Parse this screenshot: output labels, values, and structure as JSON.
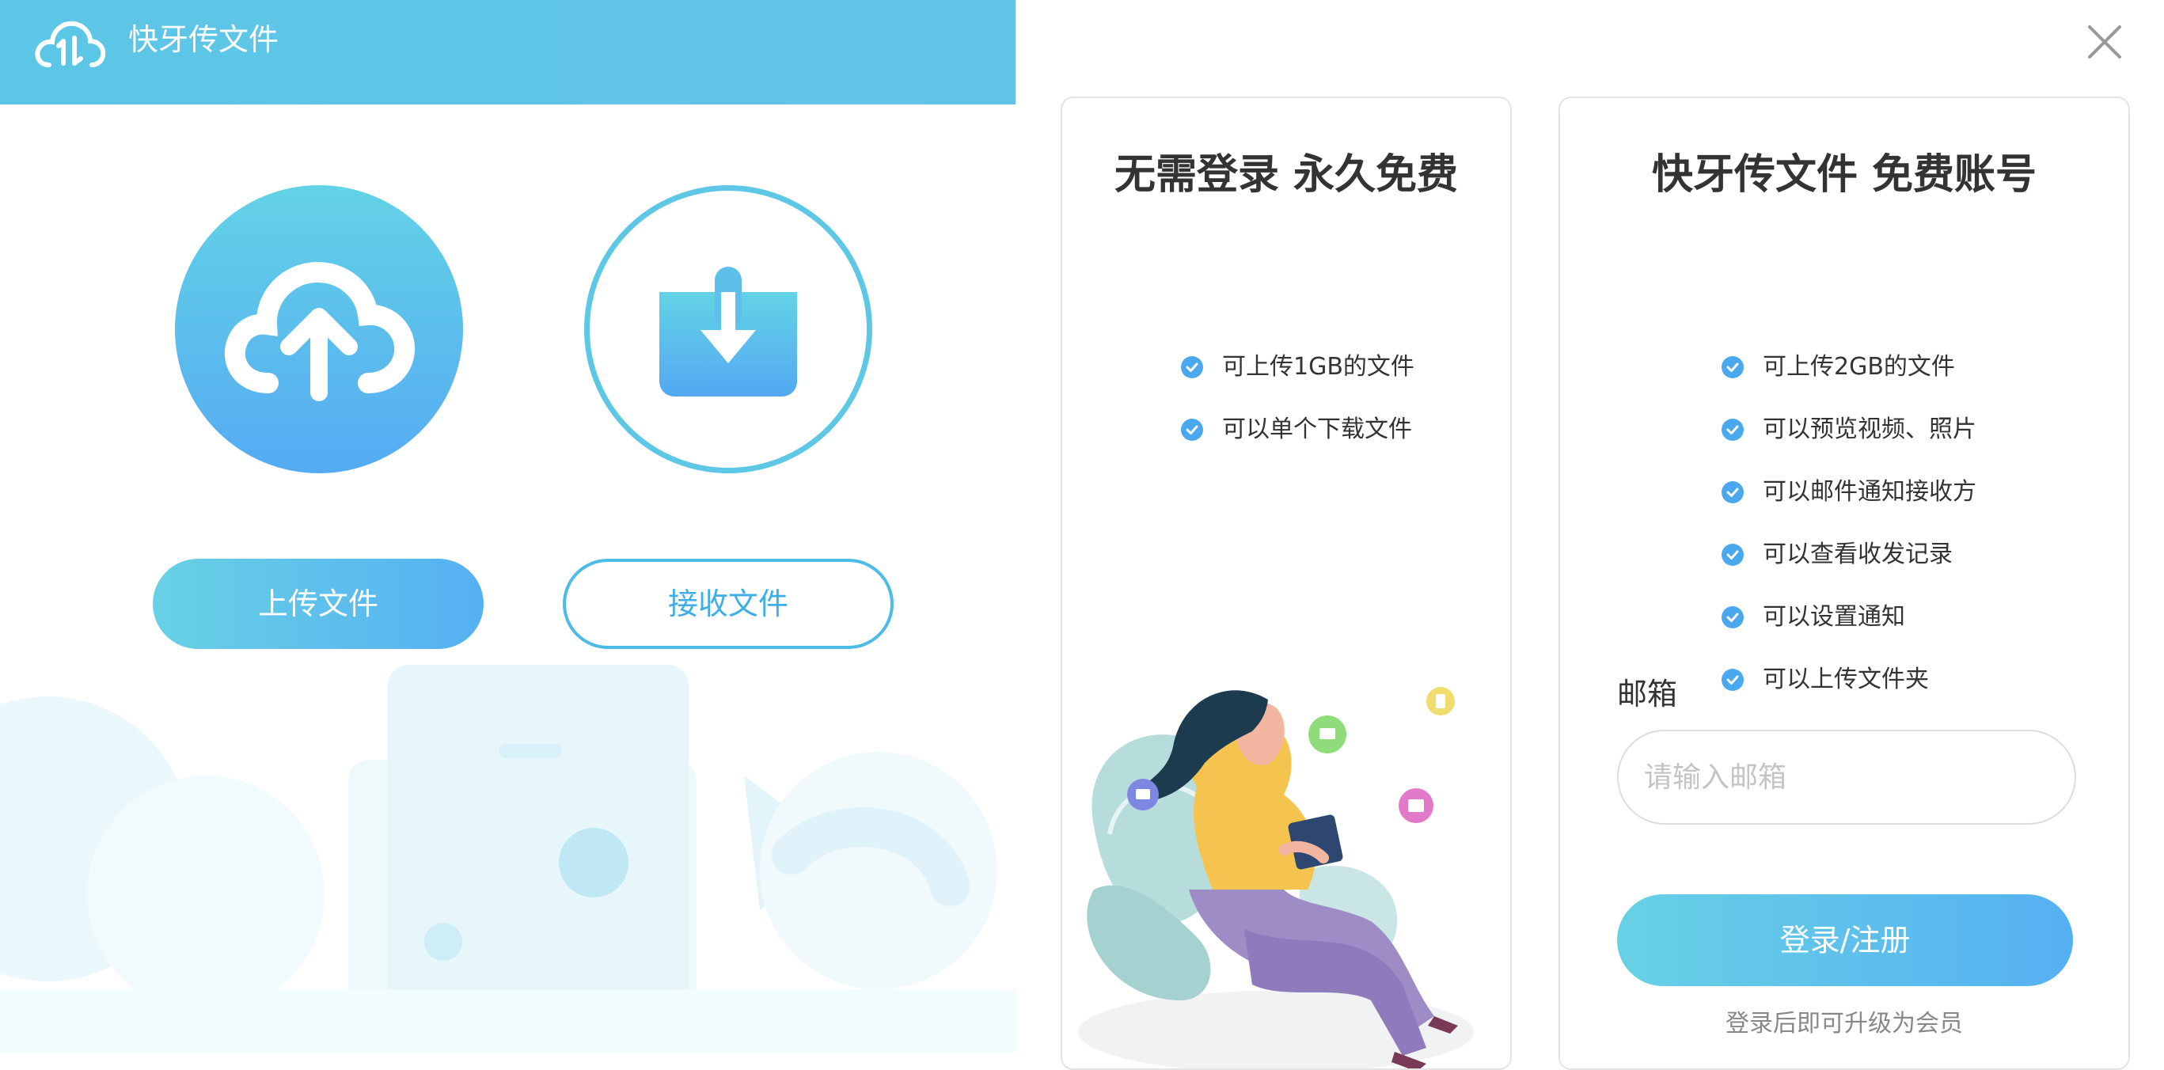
{
  "app": {
    "title": "快牙传文件"
  },
  "left": {
    "upload_button": "上传文件",
    "receive_button": "接收文件"
  },
  "free_plan": {
    "title": "无需登录 永久免费",
    "features": [
      "可上传1GB的文件",
      "可以单个下载文件"
    ]
  },
  "account_plan": {
    "title": "快牙传文件 免费账号",
    "features": [
      "可上传2GB的文件",
      "可以预览视频、照片",
      "可以邮件通知接收方",
      "可以查看收发记录",
      "可以设置通知",
      "可以上传文件夹"
    ],
    "email_label": "邮箱",
    "email_placeholder": "请输入邮箱",
    "email_value": "",
    "login_button": "登录/注册",
    "upgrade_note": "登录后即可升级为会员"
  },
  "icons": {
    "logo": "cloud-logo-icon",
    "upload": "cloud-upload-icon",
    "receive": "inbox-download-icon",
    "check": "check-circle-icon",
    "close": "close-icon"
  },
  "colors": {
    "titlebar": "#5cc6e6",
    "accent": "#4dbbe8",
    "gradient_start": "#68d1e5",
    "gradient_end": "#55b0f2",
    "check": "#4aa8ee"
  }
}
